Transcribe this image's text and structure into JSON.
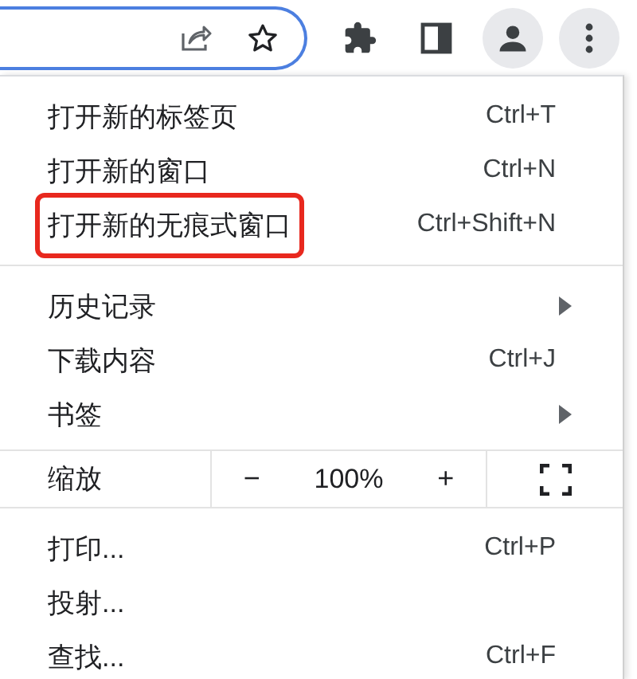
{
  "toolbar": {
    "menu_open": true
  },
  "menu": {
    "groups": [
      {
        "kind": "items",
        "items": [
          {
            "label": "打开新的标签页",
            "shortcut": "Ctrl+T",
            "submenu": false,
            "highlighted": false
          },
          {
            "label": "打开新的窗口",
            "shortcut": "Ctrl+N",
            "submenu": false,
            "highlighted": false
          },
          {
            "label": "打开新的无痕式窗口",
            "shortcut": "Ctrl+Shift+N",
            "submenu": false,
            "highlighted": true
          }
        ]
      },
      {
        "kind": "items",
        "items": [
          {
            "label": "历史记录",
            "submenu": true,
            "highlighted": false
          },
          {
            "label": "下载内容",
            "shortcut": "Ctrl+J",
            "submenu": false,
            "highlighted": false
          },
          {
            "label": "书签",
            "submenu": true,
            "highlighted": false
          }
        ]
      },
      {
        "kind": "zoom",
        "label": "缩放",
        "minus": "−",
        "value": "100%",
        "plus": "+"
      },
      {
        "kind": "items",
        "items": [
          {
            "label": "打印...",
            "shortcut": "Ctrl+P",
            "submenu": false,
            "highlighted": false
          },
          {
            "label": "投射...",
            "submenu": false,
            "highlighted": false
          },
          {
            "label": "查找...",
            "shortcut": "Ctrl+F",
            "submenu": false,
            "highlighted": false
          }
        ]
      }
    ]
  }
}
